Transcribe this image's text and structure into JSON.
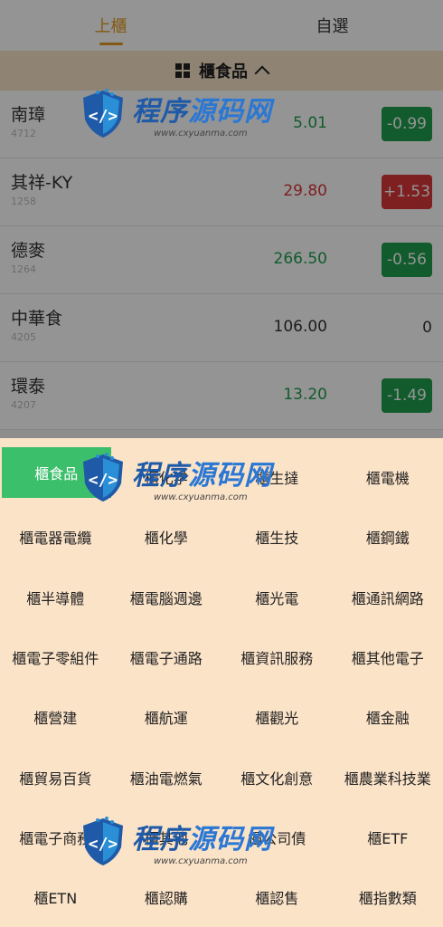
{
  "tabs": [
    {
      "label": "上櫃",
      "active": true
    },
    {
      "label": "自選",
      "active": false
    }
  ],
  "category_bar": {
    "label": "櫃食品"
  },
  "stocks": [
    {
      "name": "南璋",
      "code": "4712",
      "price": "5.01",
      "change": "-0.99",
      "dir": "down"
    },
    {
      "name": "其祥-KY",
      "code": "1258",
      "price": "29.80",
      "change": "+1.53",
      "dir": "up"
    },
    {
      "name": "德麥",
      "code": "1264",
      "price": "266.50",
      "change": "-0.56",
      "dir": "down"
    },
    {
      "name": "中華食",
      "code": "4205",
      "price": "106.00",
      "change": "0",
      "dir": "flat"
    },
    {
      "name": "環泰",
      "code": "4207",
      "price": "13.20",
      "change": "-1.49",
      "dir": "down"
    }
  ],
  "categories": [
    "櫃食品",
    "櫃化学",
    "櫃生撻",
    "櫃電機",
    "櫃電器電纜",
    "櫃化學",
    "櫃生技",
    "櫃鋼鐵",
    "櫃半導體",
    "櫃電腦週邊",
    "櫃光電",
    "櫃通訊網路",
    "櫃電子零組件",
    "櫃電子通路",
    "櫃資訊服務",
    "櫃其他電子",
    "櫃營建",
    "櫃航運",
    "櫃觀光",
    "櫃金融",
    "櫃貿易百貨",
    "櫃油電燃氣",
    "櫃文化創意",
    "櫃農業科技業",
    "櫃電子商務",
    "櫃其他",
    "櫃公司債",
    "櫃ETF",
    "櫃ETN",
    "櫃認購",
    "櫃認售",
    "櫃指數類"
  ],
  "active_category_index": 0,
  "colors": {
    "up": "#d9363a",
    "down": "#1e9e4c",
    "accent": "#e09a1f",
    "active_cat": "#3cbf6b"
  },
  "watermark": {
    "title_a": "程序",
    "title_b": "源码网",
    "url": "www.cxyuanma.com"
  }
}
